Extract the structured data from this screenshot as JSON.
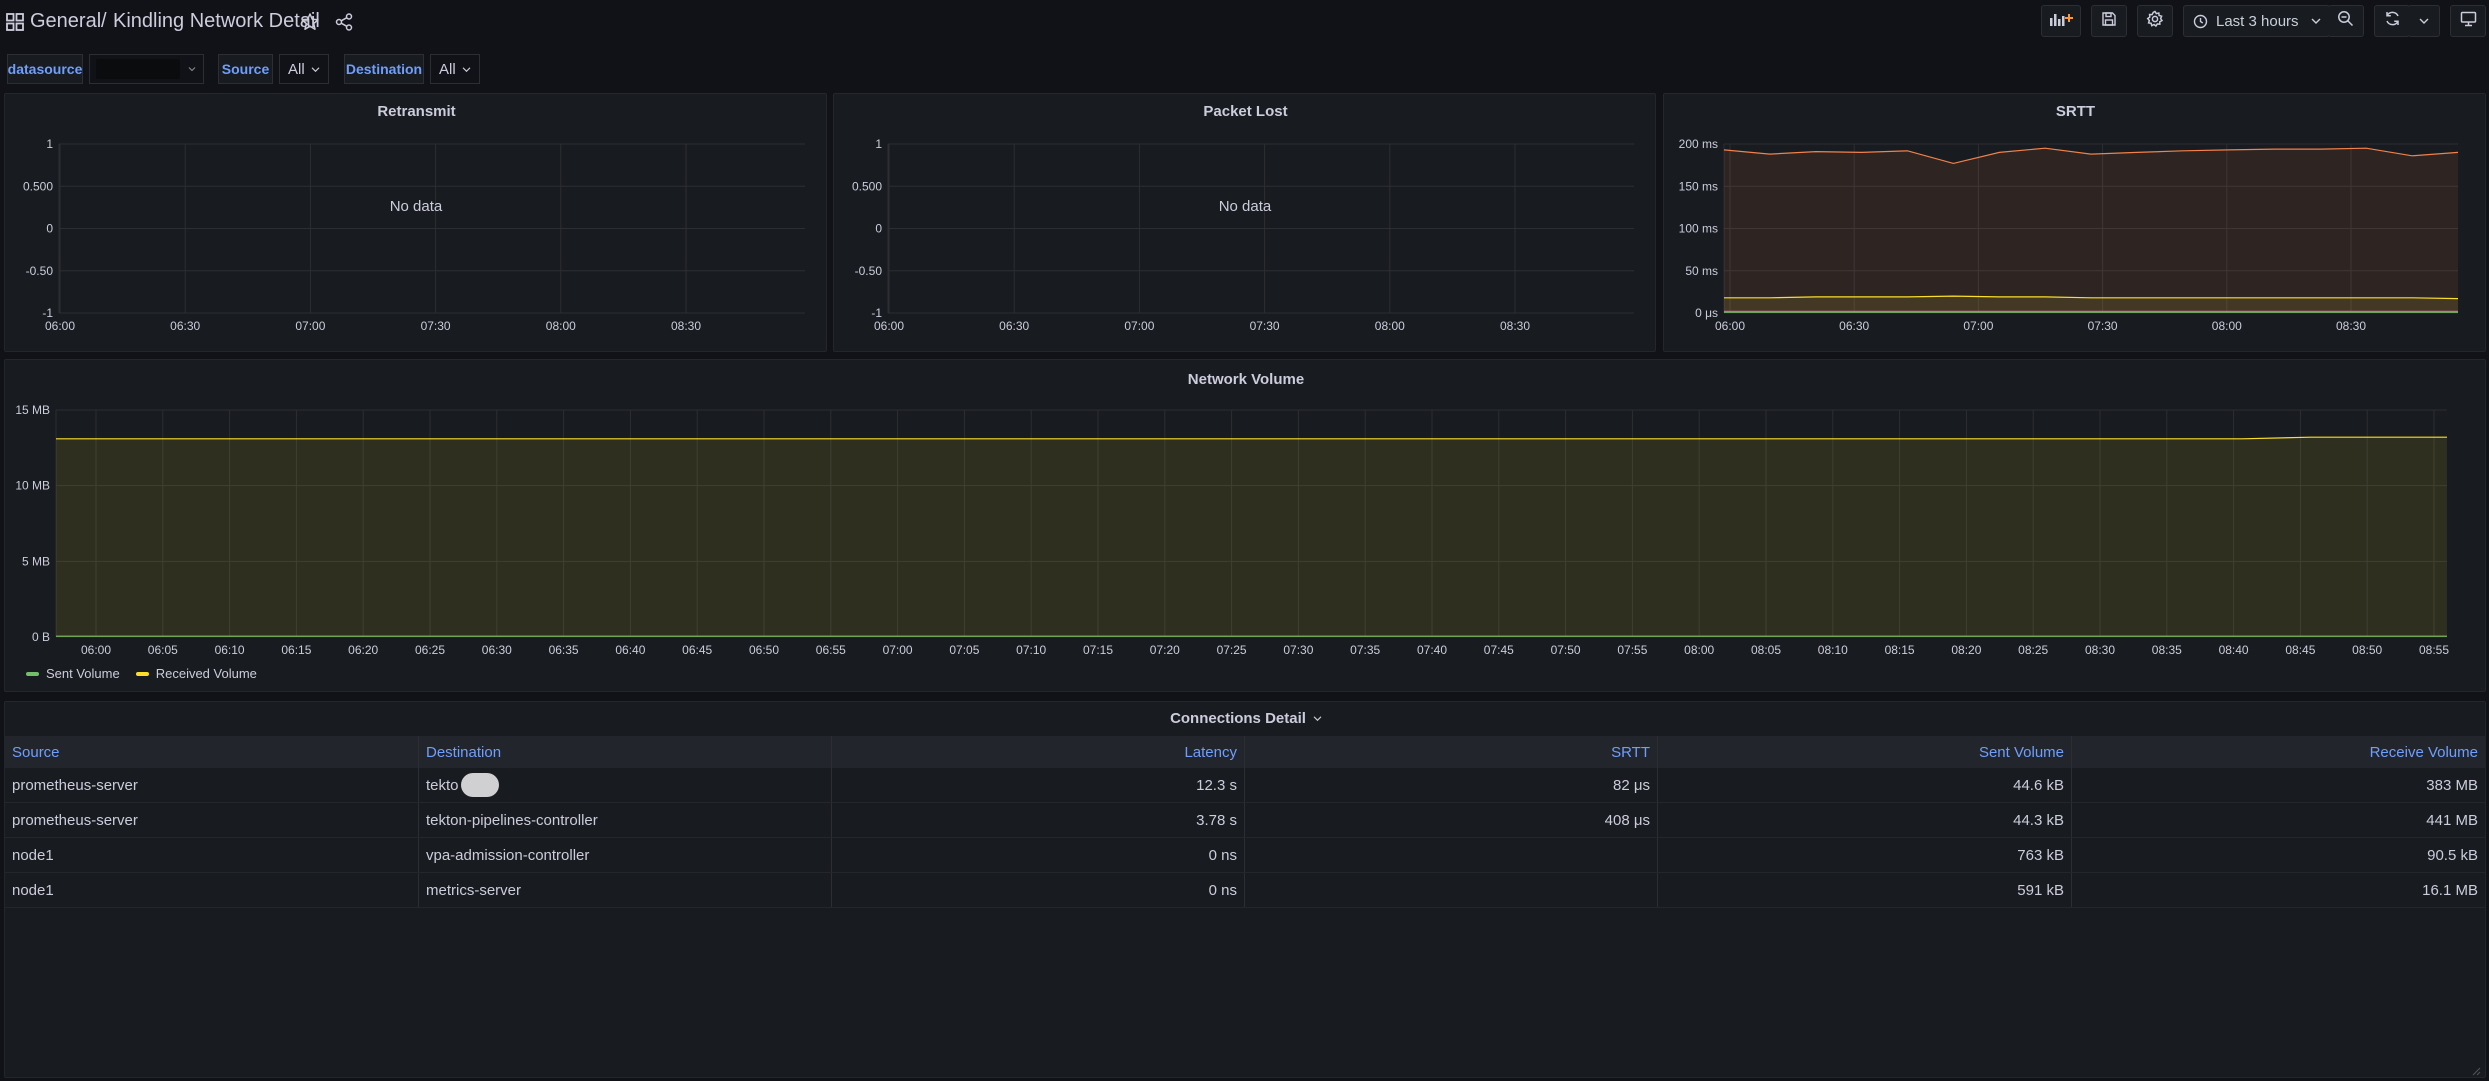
{
  "header": {
    "folder": "General",
    "separator": "/",
    "title": "Kindling Network Detail",
    "time_range": "Last 3 hours"
  },
  "variables": {
    "datasource_label": "datasource",
    "source_label": "Source",
    "source_value": "All",
    "destination_label": "Destination",
    "destination_value": "All"
  },
  "panels": {
    "retransmit": {
      "title": "Retransmit",
      "no_data": "No data"
    },
    "packet_lost": {
      "title": "Packet Lost",
      "no_data": "No data"
    },
    "srtt": {
      "title": "SRTT"
    },
    "network_volume": {
      "title": "Network Volume"
    },
    "connections": {
      "title": "Connections Detail"
    }
  },
  "chart_data": [
    {
      "type": "line",
      "title": "Retransmit",
      "x": [
        "06:00",
        "06:30",
        "07:00",
        "07:30",
        "08:00",
        "08:30"
      ],
      "ytick_labels": [
        "1",
        "0.500",
        "0",
        "-0.50",
        "-1"
      ],
      "ylim": [
        -1,
        1
      ],
      "series": [],
      "annotation": "No data",
      "grid": true
    },
    {
      "type": "line",
      "title": "Packet Lost",
      "x": [
        "06:00",
        "06:30",
        "07:00",
        "07:30",
        "08:00",
        "08:30"
      ],
      "ytick_labels": [
        "1",
        "0.500",
        "0",
        "-0.50",
        "-1"
      ],
      "ylim": [
        -1,
        1
      ],
      "series": [],
      "annotation": "No data",
      "grid": true
    },
    {
      "type": "area",
      "title": "SRTT",
      "x": [
        "06:00",
        "06:30",
        "07:00",
        "07:30",
        "08:00",
        "08:30"
      ],
      "ytick_labels": [
        "200 ms",
        "150 ms",
        "100 ms",
        "50 ms",
        "0 μs"
      ],
      "ylim": [
        0,
        200
      ],
      "y_unit": "ms",
      "series": [
        {
          "color": "#f2814a",
          "values": [
            193,
            188,
            191,
            190,
            192,
            177,
            190,
            195,
            188,
            190,
            192,
            193,
            194,
            194,
            195,
            186,
            190
          ]
        },
        {
          "color": "#fade2a",
          "values": [
            18,
            18,
            19,
            19,
            19,
            20,
            19,
            19,
            18,
            18,
            18,
            18,
            18,
            18,
            18,
            18,
            17
          ]
        },
        {
          "color": "#e05ab4",
          "values": [
            2,
            2,
            2,
            2,
            2,
            2,
            2,
            2,
            2,
            2,
            2,
            2,
            2,
            2,
            2,
            2,
            2
          ]
        },
        {
          "color": "#73bf69",
          "values": [
            1,
            1,
            1,
            1,
            1,
            1,
            1,
            1,
            1,
            1,
            1,
            1,
            1,
            1,
            1,
            1,
            1
          ]
        }
      ],
      "grid": true
    },
    {
      "type": "area",
      "title": "Network Volume",
      "x": [
        "06:00",
        "06:05",
        "06:10",
        "06:15",
        "06:20",
        "06:25",
        "06:30",
        "06:35",
        "06:40",
        "06:45",
        "06:50",
        "06:55",
        "07:00",
        "07:05",
        "07:10",
        "07:15",
        "07:20",
        "07:25",
        "07:30",
        "07:35",
        "07:40",
        "07:45",
        "07:50",
        "07:55",
        "08:00",
        "08:05",
        "08:10",
        "08:15",
        "08:20",
        "08:25",
        "08:30",
        "08:35",
        "08:40",
        "08:45",
        "08:50",
        "08:55"
      ],
      "ytick_labels": [
        "15 MB",
        "10 MB",
        "5 MB",
        "0 B"
      ],
      "ylim": [
        0,
        15
      ],
      "y_unit": "MB",
      "series": [
        {
          "name": "Sent Volume",
          "color": "#73bf69",
          "values": [
            0.05,
            0.05,
            0.05,
            0.05,
            0.05,
            0.05,
            0.05,
            0.05,
            0.05,
            0.05,
            0.05,
            0.05,
            0.05,
            0.05,
            0.05,
            0.05,
            0.05,
            0.05,
            0.05,
            0.05,
            0.05,
            0.05,
            0.05,
            0.05,
            0.05,
            0.05,
            0.05,
            0.05,
            0.05,
            0.05,
            0.05,
            0.05,
            0.05,
            0.05,
            0.05,
            0.05
          ]
        },
        {
          "name": "Received Volume",
          "color": "#fade2a",
          "values": [
            13.1,
            13.1,
            13.1,
            13.1,
            13.1,
            13.1,
            13.1,
            13.1,
            13.1,
            13.1,
            13.1,
            13.1,
            13.1,
            13.1,
            13.1,
            13.1,
            13.1,
            13.1,
            13.1,
            13.1,
            13.1,
            13.1,
            13.1,
            13.1,
            13.1,
            13.1,
            13.1,
            13.1,
            13.1,
            13.1,
            13.1,
            13.1,
            13.1,
            13.2,
            13.2,
            13.2
          ]
        }
      ],
      "legend": "bottom-left",
      "grid": true
    }
  ],
  "table": {
    "columns": [
      "Source",
      "Destination",
      "Latency",
      "SRTT",
      "Sent Volume",
      "Receive Volume"
    ],
    "rows": [
      [
        "prometheus-server",
        "tekto",
        "12.3 s",
        "82 μs",
        "44.6 kB",
        "383 MB"
      ],
      [
        "prometheus-server",
        "tekton-pipelines-controller",
        "3.78 s",
        "408 μs",
        "44.3 kB",
        "441 MB"
      ],
      [
        "node1",
        "vpa-admission-controller",
        "0 ns",
        "",
        "763 kB",
        "90.5 kB"
      ],
      [
        "node1",
        "metrics-server",
        "0 ns",
        "",
        "591 kB",
        "16.1 MB"
      ]
    ]
  }
}
